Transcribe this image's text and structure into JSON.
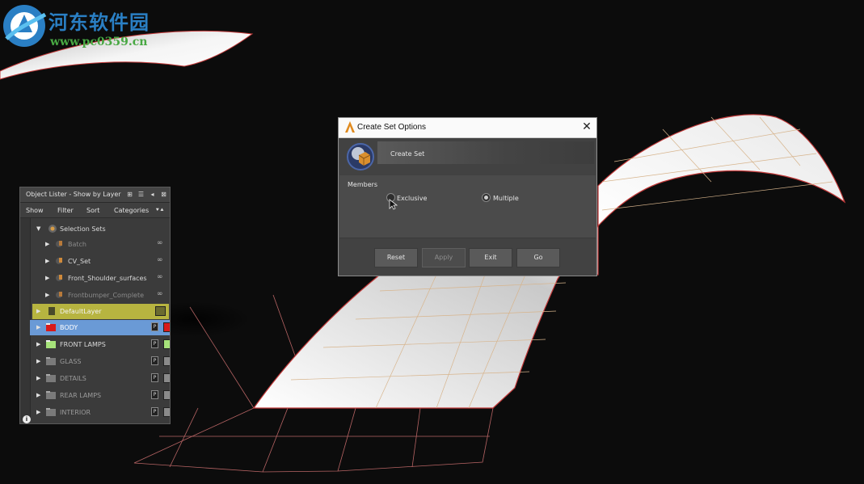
{
  "watermark": {
    "title": "河东软件园",
    "url": "www.pc0359.cn"
  },
  "lister": {
    "title": "Object Lister - Show by Layer",
    "menu": [
      "Show",
      "Filter",
      "Sort",
      "Categories"
    ],
    "rows": [
      {
        "label": "Selection Sets",
        "color": "#e6e6e6",
        "bg": ""
      },
      {
        "label": "Batch",
        "color": "#9a9a9a",
        "bg": ""
      },
      {
        "label": "CV_Set",
        "color": "#e6e6e6",
        "bg": ""
      },
      {
        "label": "Front_Shoulder_surfaces",
        "color": "#e6e6e6",
        "bg": ""
      },
      {
        "label": "Frontbumper_Complete",
        "color": "#9a9a9a",
        "bg": ""
      },
      {
        "label": "DefaultLayer",
        "color": "#f2f2f2",
        "bg": "#b7b440",
        "swatch": "#6b6b30",
        "p": ""
      },
      {
        "label": "BODY",
        "color": "#ffffff",
        "bg": "#6a9ad6",
        "swatch": "#d81a1a",
        "p": "P"
      },
      {
        "label": "FRONT LAMPS",
        "color": "#e6e6e6",
        "bg": "",
        "swatch": "#a6e27a",
        "p": "P"
      },
      {
        "label": "GLASS",
        "color": "#9a9a9a",
        "bg": "",
        "swatch": "#8a8a8a",
        "p": "P"
      },
      {
        "label": "DETAILS",
        "color": "#9a9a9a",
        "bg": "",
        "swatch": "#8a8a8a",
        "p": "P"
      },
      {
        "label": "REAR LAMPS",
        "color": "#9a9a9a",
        "bg": "",
        "swatch": "#8a8a8a",
        "p": "P"
      },
      {
        "label": "INTERIOR",
        "color": "#9a9a9a",
        "bg": "",
        "swatch": "#8a8a8a",
        "p": "P"
      }
    ]
  },
  "dialog": {
    "title": "Create Set Options",
    "header_label": "Create Set",
    "members_label": "Members",
    "options": [
      {
        "label": "Exclusive",
        "selected": false
      },
      {
        "label": "Multiple",
        "selected": true
      }
    ],
    "buttons": {
      "reset": "Reset",
      "apply": "Apply",
      "exit": "Exit",
      "go": "Go"
    }
  }
}
